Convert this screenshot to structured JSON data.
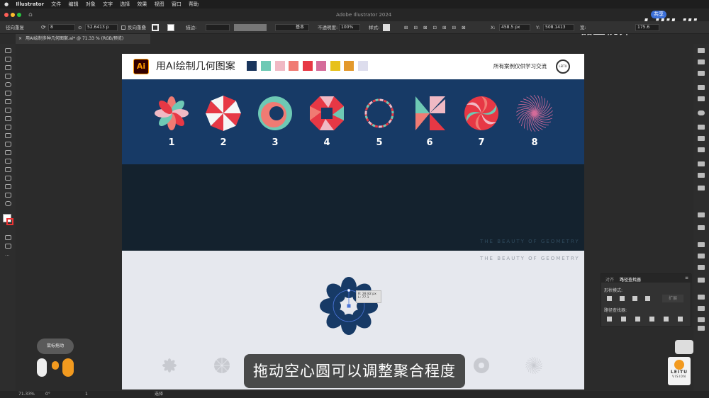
{
  "menubar": {
    "app": "Illustrator",
    "items": [
      "文件",
      "编辑",
      "对象",
      "文字",
      "选择",
      "效果",
      "视图",
      "窗口",
      "帮助"
    ]
  },
  "titlebar": {
    "title": "Adobe Illustrator 2024",
    "share": "共享"
  },
  "controlbar": {
    "path_label": "径向重复",
    "count": "8",
    "radius": "52.6413 p",
    "reverse_overlap": "反向重叠",
    "stroke_label": "描边:",
    "stroke_style": "基本",
    "opacity_label": "不透明度:",
    "opacity": "100%",
    "style_label": "样式:",
    "x_label": "X:",
    "x_value": "458.5 px",
    "y_label": "Y:",
    "y_value": "508.1413",
    "w_label": "宽:",
    "w_value": "175.6"
  },
  "document_tab": "用AI绘制多种几何图案.ai* @ 71.33 % (RGB/预览)",
  "artboard": {
    "header": {
      "logo": "Ai",
      "title": "用AI绘制几何图案",
      "right_text": "所有案例仅供学习交流",
      "badge": "LEITU"
    },
    "palette": [
      "#1a365d",
      "#6ec9b4",
      "#f0b9c4",
      "#f07b73",
      "#e73845",
      "#d56c9a",
      "#e7c11b",
      "#e3992c",
      "#dddded"
    ],
    "patterns": [
      {
        "num": "1",
        "icon": "petal-flower-icon"
      },
      {
        "num": "2",
        "icon": "umbrella-wheel-icon"
      },
      {
        "num": "3",
        "icon": "ring-swirl-icon"
      },
      {
        "num": "4",
        "icon": "octagon-aperture-icon"
      },
      {
        "num": "5",
        "icon": "dashed-ring-icon"
      },
      {
        "num": "6",
        "icon": "pinwheel-icon"
      },
      {
        "num": "7",
        "icon": "spiral-rose-icon"
      },
      {
        "num": "8",
        "icon": "line-spiral-icon"
      }
    ],
    "beauty_text_1": "THE BEAUTY OF GEOMETRY",
    "beauty_text_2": "THE BEAUTY OF GEOMETRY",
    "tooltip": {
      "r": "R: 28.82 px",
      "l": "L: 77.1"
    }
  },
  "subtitle": "拖动空心圆可以调整聚合程度",
  "find_panel": {
    "tab1": "对齐",
    "tab2": "路径查找器",
    "shape_modes": "形状模式:",
    "pathfinder": "路径查找器:",
    "expand": "扩展"
  },
  "mouse_panel": "鼠标拖动",
  "status": {
    "zoom": "71.33%",
    "angle": "0°",
    "artboard": "1",
    "tool": "选择"
  },
  "watermark": {
    "channel": "磊土视界",
    "brand": "bilibili",
    "leitu": "LEITU",
    "vision": "VISION"
  }
}
